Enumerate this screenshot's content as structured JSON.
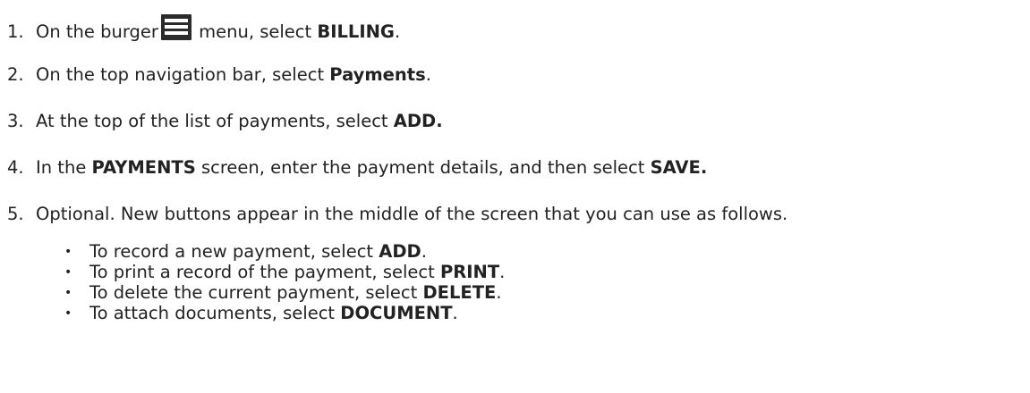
{
  "steps": [
    {
      "num": "1.",
      "pre": "On the burger",
      "post": " menu, select ",
      "bold": "BILLING",
      "tail": "."
    },
    {
      "num": "2.",
      "pre": "On the top navigation bar, select ",
      "bold": "Payments",
      "tail": "."
    },
    {
      "num": "3.",
      "pre": "At the top of the list of payments, select ",
      "bold": "ADD.",
      "tail": ""
    },
    {
      "num": "4.",
      "pre": "In the ",
      "bold": "PAYMENTS",
      "mid": " screen, enter the payment details, and then select ",
      "bold2": "SAVE.",
      "tail": ""
    },
    {
      "num": "5.",
      "pre": "Optional. New buttons appear in the middle of the screen that you can use as follows.",
      "tail": ""
    }
  ],
  "substeps": [
    {
      "bullet": "•",
      "pre": "To record a new payment, select ",
      "bold": "ADD",
      "tail": "."
    },
    {
      "bullet": "•",
      "pre": "To print a record of the payment, select ",
      "bold": "PRINT",
      "tail": "."
    },
    {
      "bullet": "•",
      "pre": "To delete the current payment, select ",
      "bold": "DELETE",
      "tail": "."
    },
    {
      "bullet": "•",
      "pre": "To attach documents, select ",
      "bold": "DOCUMENT",
      "tail": "."
    }
  ],
  "icons": {
    "burger": "burger-menu-icon"
  }
}
